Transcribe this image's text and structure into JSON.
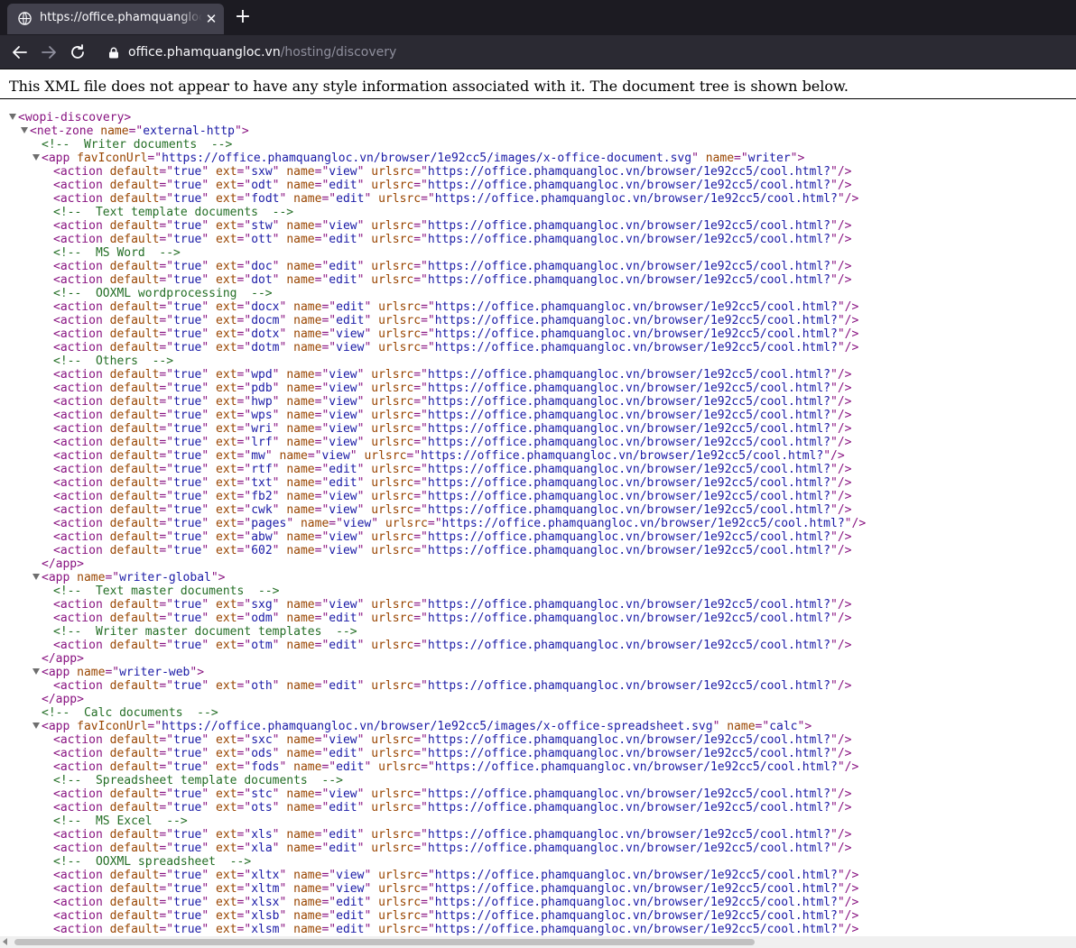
{
  "browser": {
    "tab_title": "https://office.phamquangloc",
    "url_host": "office.phamquangloc.vn",
    "url_path": "/hosting/discovery"
  },
  "page": {
    "info": "This XML file does not appear to have any style information associated with it. The document tree is shown below."
  },
  "xml_lines": [
    {
      "indent": 0,
      "twisty": true,
      "parts": [
        [
          "t",
          "<wopi-discovery>"
        ]
      ]
    },
    {
      "indent": 1,
      "twisty": true,
      "parts": [
        [
          "t",
          "<net-zone"
        ],
        [
          "p",
          " "
        ],
        [
          "a",
          "name"
        ],
        [
          "t",
          "=\""
        ],
        [
          "v",
          "external-http"
        ],
        [
          "t",
          "\">"
        ]
      ]
    },
    {
      "indent": 2,
      "twisty": false,
      "parts": [
        [
          "c",
          "<!--  Writer documents  -->"
        ]
      ]
    },
    {
      "indent": 2,
      "twisty": true,
      "parts": [
        [
          "t",
          "<app"
        ],
        [
          "p",
          " "
        ],
        [
          "a",
          "favIconUrl"
        ],
        [
          "t",
          "=\""
        ],
        [
          "v",
          "https://office.phamquangloc.vn/browser/1e92cc5/images/x-office-document.svg"
        ],
        [
          "t",
          "\""
        ],
        [
          "p",
          " "
        ],
        [
          "a",
          "name"
        ],
        [
          "t",
          "=\""
        ],
        [
          "v",
          "writer"
        ],
        [
          "t",
          "\">"
        ]
      ]
    },
    {
      "indent": 3,
      "twisty": false,
      "action": [
        "true",
        "sxw",
        "view",
        "https://office.phamquangloc.vn/browser/1e92cc5/cool.html?"
      ]
    },
    {
      "indent": 3,
      "twisty": false,
      "action": [
        "true",
        "odt",
        "edit",
        "https://office.phamquangloc.vn/browser/1e92cc5/cool.html?"
      ]
    },
    {
      "indent": 3,
      "twisty": false,
      "action": [
        "true",
        "fodt",
        "edit",
        "https://office.phamquangloc.vn/browser/1e92cc5/cool.html?"
      ]
    },
    {
      "indent": 3,
      "twisty": false,
      "parts": [
        [
          "c",
          "<!--  Text template documents  -->"
        ]
      ]
    },
    {
      "indent": 3,
      "twisty": false,
      "action": [
        "true",
        "stw",
        "view",
        "https://office.phamquangloc.vn/browser/1e92cc5/cool.html?"
      ]
    },
    {
      "indent": 3,
      "twisty": false,
      "action": [
        "true",
        "ott",
        "edit",
        "https://office.phamquangloc.vn/browser/1e92cc5/cool.html?"
      ]
    },
    {
      "indent": 3,
      "twisty": false,
      "parts": [
        [
          "c",
          "<!--  MS Word  -->"
        ]
      ]
    },
    {
      "indent": 3,
      "twisty": false,
      "action": [
        "true",
        "doc",
        "edit",
        "https://office.phamquangloc.vn/browser/1e92cc5/cool.html?"
      ]
    },
    {
      "indent": 3,
      "twisty": false,
      "action": [
        "true",
        "dot",
        "edit",
        "https://office.phamquangloc.vn/browser/1e92cc5/cool.html?"
      ]
    },
    {
      "indent": 3,
      "twisty": false,
      "parts": [
        [
          "c",
          "<!--  OOXML wordprocessing  -->"
        ]
      ]
    },
    {
      "indent": 3,
      "twisty": false,
      "action": [
        "true",
        "docx",
        "edit",
        "https://office.phamquangloc.vn/browser/1e92cc5/cool.html?"
      ]
    },
    {
      "indent": 3,
      "twisty": false,
      "action": [
        "true",
        "docm",
        "edit",
        "https://office.phamquangloc.vn/browser/1e92cc5/cool.html?"
      ]
    },
    {
      "indent": 3,
      "twisty": false,
      "action": [
        "true",
        "dotx",
        "view",
        "https://office.phamquangloc.vn/browser/1e92cc5/cool.html?"
      ]
    },
    {
      "indent": 3,
      "twisty": false,
      "action": [
        "true",
        "dotm",
        "view",
        "https://office.phamquangloc.vn/browser/1e92cc5/cool.html?"
      ]
    },
    {
      "indent": 3,
      "twisty": false,
      "parts": [
        [
          "c",
          "<!--  Others  -->"
        ]
      ]
    },
    {
      "indent": 3,
      "twisty": false,
      "action": [
        "true",
        "wpd",
        "view",
        "https://office.phamquangloc.vn/browser/1e92cc5/cool.html?"
      ]
    },
    {
      "indent": 3,
      "twisty": false,
      "action": [
        "true",
        "pdb",
        "view",
        "https://office.phamquangloc.vn/browser/1e92cc5/cool.html?"
      ]
    },
    {
      "indent": 3,
      "twisty": false,
      "action": [
        "true",
        "hwp",
        "view",
        "https://office.phamquangloc.vn/browser/1e92cc5/cool.html?"
      ]
    },
    {
      "indent": 3,
      "twisty": false,
      "action": [
        "true",
        "wps",
        "view",
        "https://office.phamquangloc.vn/browser/1e92cc5/cool.html?"
      ]
    },
    {
      "indent": 3,
      "twisty": false,
      "action": [
        "true",
        "wri",
        "view",
        "https://office.phamquangloc.vn/browser/1e92cc5/cool.html?"
      ]
    },
    {
      "indent": 3,
      "twisty": false,
      "action": [
        "true",
        "lrf",
        "view",
        "https://office.phamquangloc.vn/browser/1e92cc5/cool.html?"
      ]
    },
    {
      "indent": 3,
      "twisty": false,
      "action": [
        "true",
        "mw",
        "view",
        "https://office.phamquangloc.vn/browser/1e92cc5/cool.html?"
      ]
    },
    {
      "indent": 3,
      "twisty": false,
      "action": [
        "true",
        "rtf",
        "edit",
        "https://office.phamquangloc.vn/browser/1e92cc5/cool.html?"
      ]
    },
    {
      "indent": 3,
      "twisty": false,
      "action": [
        "true",
        "txt",
        "edit",
        "https://office.phamquangloc.vn/browser/1e92cc5/cool.html?"
      ]
    },
    {
      "indent": 3,
      "twisty": false,
      "action": [
        "true",
        "fb2",
        "view",
        "https://office.phamquangloc.vn/browser/1e92cc5/cool.html?"
      ]
    },
    {
      "indent": 3,
      "twisty": false,
      "action": [
        "true",
        "cwk",
        "view",
        "https://office.phamquangloc.vn/browser/1e92cc5/cool.html?"
      ]
    },
    {
      "indent": 3,
      "twisty": false,
      "action": [
        "true",
        "pages",
        "view",
        "https://office.phamquangloc.vn/browser/1e92cc5/cool.html?"
      ]
    },
    {
      "indent": 3,
      "twisty": false,
      "action": [
        "true",
        "abw",
        "view",
        "https://office.phamquangloc.vn/browser/1e92cc5/cool.html?"
      ]
    },
    {
      "indent": 3,
      "twisty": false,
      "action": [
        "true",
        "602",
        "view",
        "https://office.phamquangloc.vn/browser/1e92cc5/cool.html?"
      ]
    },
    {
      "indent": 2,
      "twisty": false,
      "parts": [
        [
          "t",
          "</app>"
        ]
      ]
    },
    {
      "indent": 2,
      "twisty": true,
      "parts": [
        [
          "t",
          "<app"
        ],
        [
          "p",
          " "
        ],
        [
          "a",
          "name"
        ],
        [
          "t",
          "=\""
        ],
        [
          "v",
          "writer-global"
        ],
        [
          "t",
          "\">"
        ]
      ]
    },
    {
      "indent": 3,
      "twisty": false,
      "parts": [
        [
          "c",
          "<!--  Text master documents  -->"
        ]
      ]
    },
    {
      "indent": 3,
      "twisty": false,
      "action": [
        "true",
        "sxg",
        "view",
        "https://office.phamquangloc.vn/browser/1e92cc5/cool.html?"
      ]
    },
    {
      "indent": 3,
      "twisty": false,
      "action": [
        "true",
        "odm",
        "edit",
        "https://office.phamquangloc.vn/browser/1e92cc5/cool.html?"
      ]
    },
    {
      "indent": 3,
      "twisty": false,
      "parts": [
        [
          "c",
          "<!--  Writer master document templates  -->"
        ]
      ]
    },
    {
      "indent": 3,
      "twisty": false,
      "action": [
        "true",
        "otm",
        "edit",
        "https://office.phamquangloc.vn/browser/1e92cc5/cool.html?"
      ]
    },
    {
      "indent": 2,
      "twisty": false,
      "parts": [
        [
          "t",
          "</app>"
        ]
      ]
    },
    {
      "indent": 2,
      "twisty": true,
      "parts": [
        [
          "t",
          "<app"
        ],
        [
          "p",
          " "
        ],
        [
          "a",
          "name"
        ],
        [
          "t",
          "=\""
        ],
        [
          "v",
          "writer-web"
        ],
        [
          "t",
          "\">"
        ]
      ]
    },
    {
      "indent": 3,
      "twisty": false,
      "action": [
        "true",
        "oth",
        "edit",
        "https://office.phamquangloc.vn/browser/1e92cc5/cool.html?"
      ]
    },
    {
      "indent": 2,
      "twisty": false,
      "parts": [
        [
          "t",
          "</app>"
        ]
      ]
    },
    {
      "indent": 2,
      "twisty": false,
      "parts": [
        [
          "c",
          "<!--  Calc documents  -->"
        ]
      ]
    },
    {
      "indent": 2,
      "twisty": true,
      "parts": [
        [
          "t",
          "<app"
        ],
        [
          "p",
          " "
        ],
        [
          "a",
          "favIconUrl"
        ],
        [
          "t",
          "=\""
        ],
        [
          "v",
          "https://office.phamquangloc.vn/browser/1e92cc5/images/x-office-spreadsheet.svg"
        ],
        [
          "t",
          "\""
        ],
        [
          "p",
          " "
        ],
        [
          "a",
          "name"
        ],
        [
          "t",
          "=\""
        ],
        [
          "v",
          "calc"
        ],
        [
          "t",
          "\">"
        ]
      ]
    },
    {
      "indent": 3,
      "twisty": false,
      "action": [
        "true",
        "sxc",
        "view",
        "https://office.phamquangloc.vn/browser/1e92cc5/cool.html?"
      ]
    },
    {
      "indent": 3,
      "twisty": false,
      "action": [
        "true",
        "ods",
        "edit",
        "https://office.phamquangloc.vn/browser/1e92cc5/cool.html?"
      ]
    },
    {
      "indent": 3,
      "twisty": false,
      "action": [
        "true",
        "fods",
        "edit",
        "https://office.phamquangloc.vn/browser/1e92cc5/cool.html?"
      ]
    },
    {
      "indent": 3,
      "twisty": false,
      "parts": [
        [
          "c",
          "<!--  Spreadsheet template documents  -->"
        ]
      ]
    },
    {
      "indent": 3,
      "twisty": false,
      "action": [
        "true",
        "stc",
        "view",
        "https://office.phamquangloc.vn/browser/1e92cc5/cool.html?"
      ]
    },
    {
      "indent": 3,
      "twisty": false,
      "action": [
        "true",
        "ots",
        "edit",
        "https://office.phamquangloc.vn/browser/1e92cc5/cool.html?"
      ]
    },
    {
      "indent": 3,
      "twisty": false,
      "parts": [
        [
          "c",
          "<!--  MS Excel  -->"
        ]
      ]
    },
    {
      "indent": 3,
      "twisty": false,
      "action": [
        "true",
        "xls",
        "edit",
        "https://office.phamquangloc.vn/browser/1e92cc5/cool.html?"
      ]
    },
    {
      "indent": 3,
      "twisty": false,
      "action": [
        "true",
        "xla",
        "edit",
        "https://office.phamquangloc.vn/browser/1e92cc5/cool.html?"
      ]
    },
    {
      "indent": 3,
      "twisty": false,
      "parts": [
        [
          "c",
          "<!--  OOXML spreadsheet  -->"
        ]
      ]
    },
    {
      "indent": 3,
      "twisty": false,
      "action": [
        "true",
        "xltx",
        "view",
        "https://office.phamquangloc.vn/browser/1e92cc5/cool.html?"
      ]
    },
    {
      "indent": 3,
      "twisty": false,
      "action": [
        "true",
        "xltm",
        "view",
        "https://office.phamquangloc.vn/browser/1e92cc5/cool.html?"
      ]
    },
    {
      "indent": 3,
      "twisty": false,
      "action": [
        "true",
        "xlsx",
        "edit",
        "https://office.phamquangloc.vn/browser/1e92cc5/cool.html?"
      ]
    },
    {
      "indent": 3,
      "twisty": false,
      "action": [
        "true",
        "xlsb",
        "edit",
        "https://office.phamquangloc.vn/browser/1e92cc5/cool.html?"
      ]
    },
    {
      "indent": 3,
      "twisty": false,
      "action": [
        "true",
        "xlsm",
        "edit",
        "https://office.phamquangloc.vn/browser/1e92cc5/cool.html?"
      ]
    }
  ],
  "colors": {
    "tag": "#881280",
    "attr_name": "#994500",
    "attr_value": "#1a1aa6",
    "comment": "#236e25",
    "tabbar": "#1c1b22",
    "toolbar": "#2b2a33"
  },
  "icons": {
    "favicon": "globe-icon",
    "tab_close": "close-icon",
    "new_tab": "plus-icon",
    "back": "arrow-left-icon",
    "forward": "arrow-right-icon",
    "reload": "reload-icon",
    "lock": "lock-icon",
    "twisty": "triangle-down-icon"
  }
}
